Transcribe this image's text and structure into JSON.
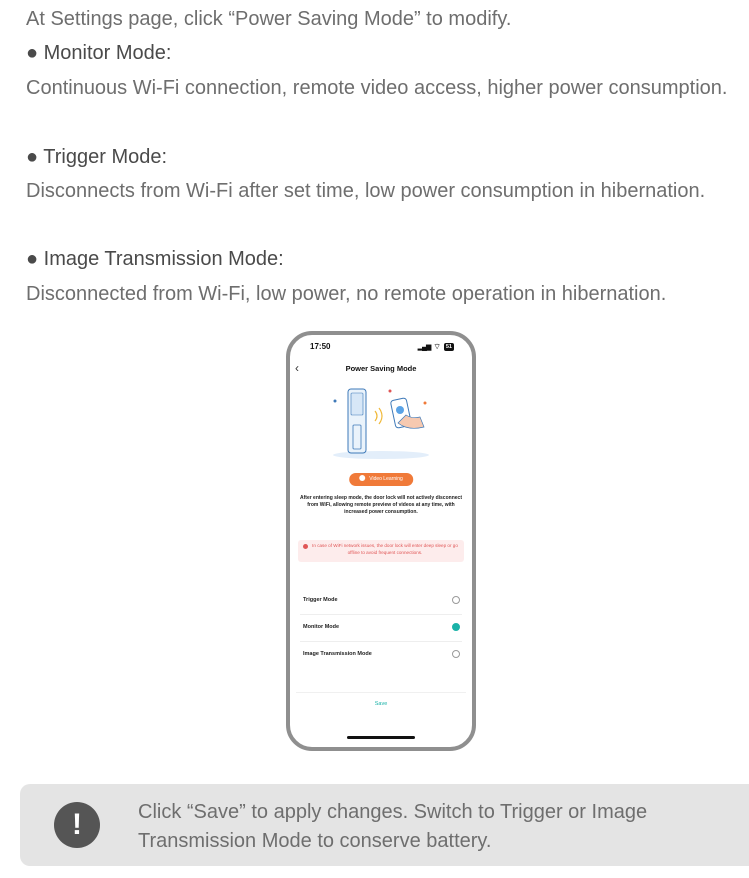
{
  "intro": "At Settings page, click “Power Saving Mode” to modify.",
  "modes": [
    {
      "title": "● Monitor Mode:",
      "desc": "Continuous Wi-Fi connection, remote video access, higher power consumption."
    },
    {
      "title": "● Trigger Mode:",
      "desc": "Disconnects from Wi-Fi after set time, low power consumption in hibernation."
    },
    {
      "title": "● Image Transmission Mode:",
      "desc": "Disconnected from Wi-Fi, low power, no remote operation in hibernation."
    }
  ],
  "phone": {
    "time": "17:50",
    "battery": "51",
    "title": "Power Saving Mode",
    "video_button": "Video Learning",
    "description": "After entering sleep mode, the door lock will not actively disconnect from WiFi, allowing remote preview of videos at any time, with increased power consumption.",
    "warning": "In case of WiFi network issues, the door lock will enter deep sleep or go offline to avoid frequent connections.",
    "options": [
      {
        "label": "Trigger Mode",
        "selected": false
      },
      {
        "label": "Monitor Mode",
        "selected": true
      },
      {
        "label": "Image Transmission Mode",
        "selected": false
      }
    ],
    "save": "Save",
    "accent_color": "#1ab2a8",
    "button_color": "#f07a39"
  },
  "note": {
    "icon": "!",
    "text": "Click “Save” to apply changes. Switch to Trigger or Image Transmission Mode to conserve battery."
  }
}
